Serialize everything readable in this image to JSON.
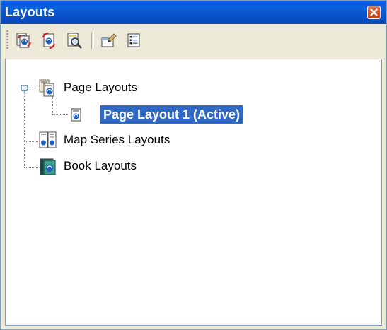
{
  "window": {
    "title": "Layouts"
  },
  "toolbar": {
    "buttons": [
      {
        "icon": "layout-refresh-icon"
      },
      {
        "icon": "layout-sync-icon"
      },
      {
        "icon": "layout-zoom-icon"
      },
      {
        "icon": "layout-properties-icon"
      },
      {
        "icon": "list-view-icon"
      }
    ]
  },
  "tree": {
    "page_layouts": {
      "label": "Page Layouts",
      "expanded": true
    },
    "page_layout_1": {
      "label": "Page Layout 1 (Active)",
      "selected": true
    },
    "map_series_layouts": {
      "label": "Map Series Layouts"
    },
    "book_layouts": {
      "label": "Book Layouts"
    }
  },
  "colors": {
    "title_bar": "#0a5ff0",
    "selection": "#316ac5",
    "close_button": "#d8501f",
    "chrome": "#ece9d8"
  }
}
